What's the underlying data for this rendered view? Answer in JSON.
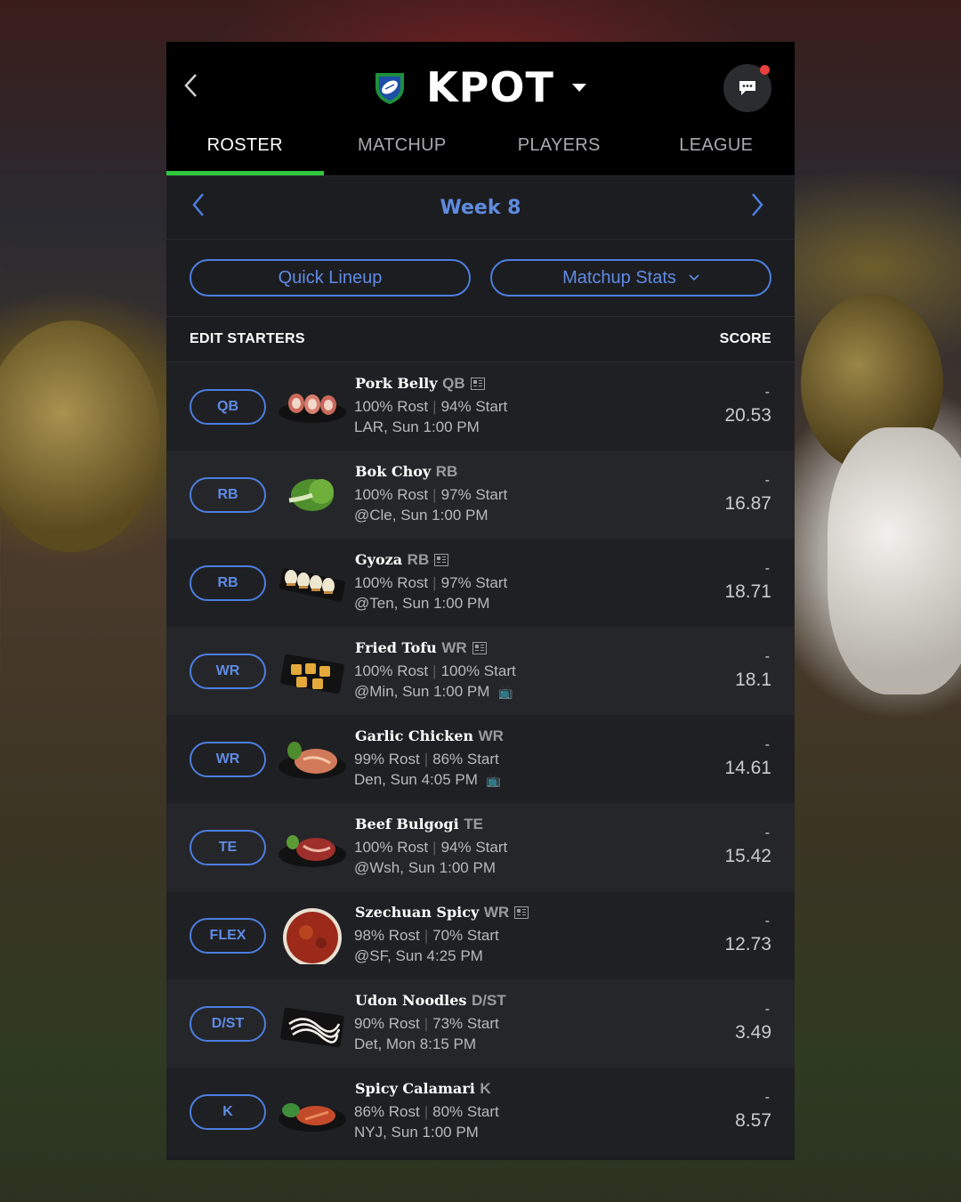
{
  "header": {
    "team_name": "KPOT",
    "tabs": [
      {
        "label": "ROSTER",
        "active": true
      },
      {
        "label": "MATCHUP",
        "active": false
      },
      {
        "label": "PLAYERS",
        "active": false
      },
      {
        "label": "LEAGUE",
        "active": false
      }
    ]
  },
  "week": {
    "label": "Week 8"
  },
  "buttons": {
    "quick_lineup": "Quick Lineup",
    "matchup_stats": "Matchup Stats"
  },
  "section": {
    "left": "EDIT STARTERS",
    "right": "SCORE"
  },
  "colors": {
    "accent_blue": "#4c7ee0",
    "active_tab": "#2fc73c",
    "notification_dot": "#e8403e"
  },
  "players": [
    {
      "slot": "QB",
      "name": "Pork Belly",
      "pos": "QB",
      "news": true,
      "rost": "100% Rost",
      "start": "94% Start",
      "game": "LAR, Sun 1:00 PM",
      "tv": false,
      "proj": "-",
      "score": "20.53",
      "thumb": "pork"
    },
    {
      "slot": "RB",
      "name": "Bok Choy",
      "pos": "RB",
      "news": false,
      "rost": "100% Rost",
      "start": "97% Start",
      "game": "@Cle, Sun 1:00 PM",
      "tv": false,
      "proj": "-",
      "score": "16.87",
      "thumb": "bokchoy"
    },
    {
      "slot": "RB",
      "name": "Gyoza",
      "pos": "RB",
      "news": true,
      "rost": "100% Rost",
      "start": "97% Start",
      "game": "@Ten, Sun 1:00 PM",
      "tv": false,
      "proj": "-",
      "score": "18.71",
      "thumb": "gyoza"
    },
    {
      "slot": "WR",
      "name": "Fried Tofu",
      "pos": "WR",
      "news": true,
      "rost": "100% Rost",
      "start": "100% Start",
      "game": "@Min, Sun 1:00 PM",
      "tv": true,
      "proj": "-",
      "score": "18.1",
      "thumb": "tofu"
    },
    {
      "slot": "WR",
      "name": "Garlic Chicken",
      "pos": "WR",
      "news": false,
      "rost": "99% Rost",
      "start": "86% Start",
      "game": "Den, Sun 4:05 PM",
      "tv": true,
      "proj": "-",
      "score": "14.61",
      "thumb": "chicken"
    },
    {
      "slot": "TE",
      "name": "Beef Bulgogi",
      "pos": "TE",
      "news": false,
      "rost": "100% Rost",
      "start": "94% Start",
      "game": "@Wsh, Sun 1:00 PM",
      "tv": false,
      "proj": "-",
      "score": "15.42",
      "thumb": "bulgogi"
    },
    {
      "slot": "FLEX",
      "name": "Szechuan Spicy",
      "pos": "WR",
      "news": true,
      "rost": "98% Rost",
      "start": "70% Start",
      "game": "@SF, Sun 4:25 PM",
      "tv": false,
      "proj": "-",
      "score": "12.73",
      "thumb": "soup"
    },
    {
      "slot": "D/ST",
      "name": "Udon Noodles",
      "pos": "D/ST",
      "news": false,
      "rost": "90% Rost",
      "start": "73% Start",
      "game": "Det, Mon 8:15 PM",
      "tv": false,
      "proj": "-",
      "score": "3.49",
      "thumb": "udon"
    },
    {
      "slot": "K",
      "name": "Spicy Calamari",
      "pos": "K",
      "news": false,
      "rost": "86% Rost",
      "start": "80% Start",
      "game": "NYJ, Sun 1:00 PM",
      "tv": false,
      "proj": "-",
      "score": "8.57",
      "thumb": "calamari"
    }
  ]
}
